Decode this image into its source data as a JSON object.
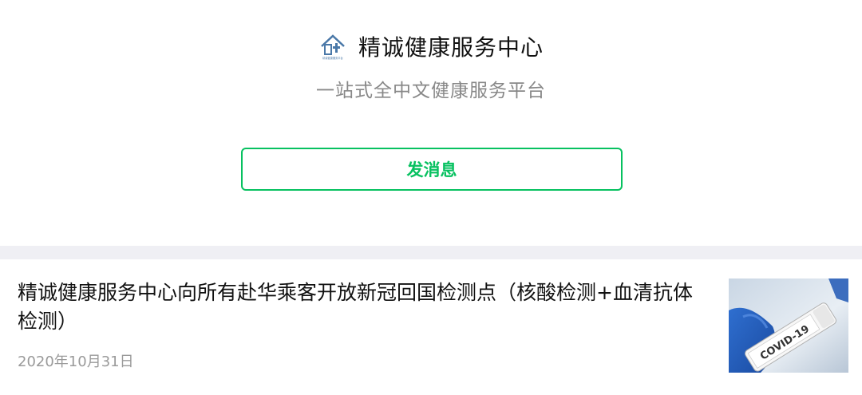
{
  "account": {
    "name": "精诚健康服务中心",
    "tagline": "一站式全中文健康服务平台",
    "logo_icon": "house-cross-icon",
    "logo_caption": "精诚健康服务平台"
  },
  "actions": {
    "message_label": "发消息"
  },
  "colors": {
    "accent": "#07c160",
    "divider": "#efeff4",
    "title": "#111111",
    "secondary": "#888888"
  },
  "articles": [
    {
      "title": "精诚健康服务中心向所有赴华乘客开放新冠回国检测点（核酸检测+血清抗体检测）",
      "date": "2020年10月31日",
      "thumbnail_icon": "covid-test-tube-icon",
      "thumbnail_text": "COVID-19"
    }
  ]
}
